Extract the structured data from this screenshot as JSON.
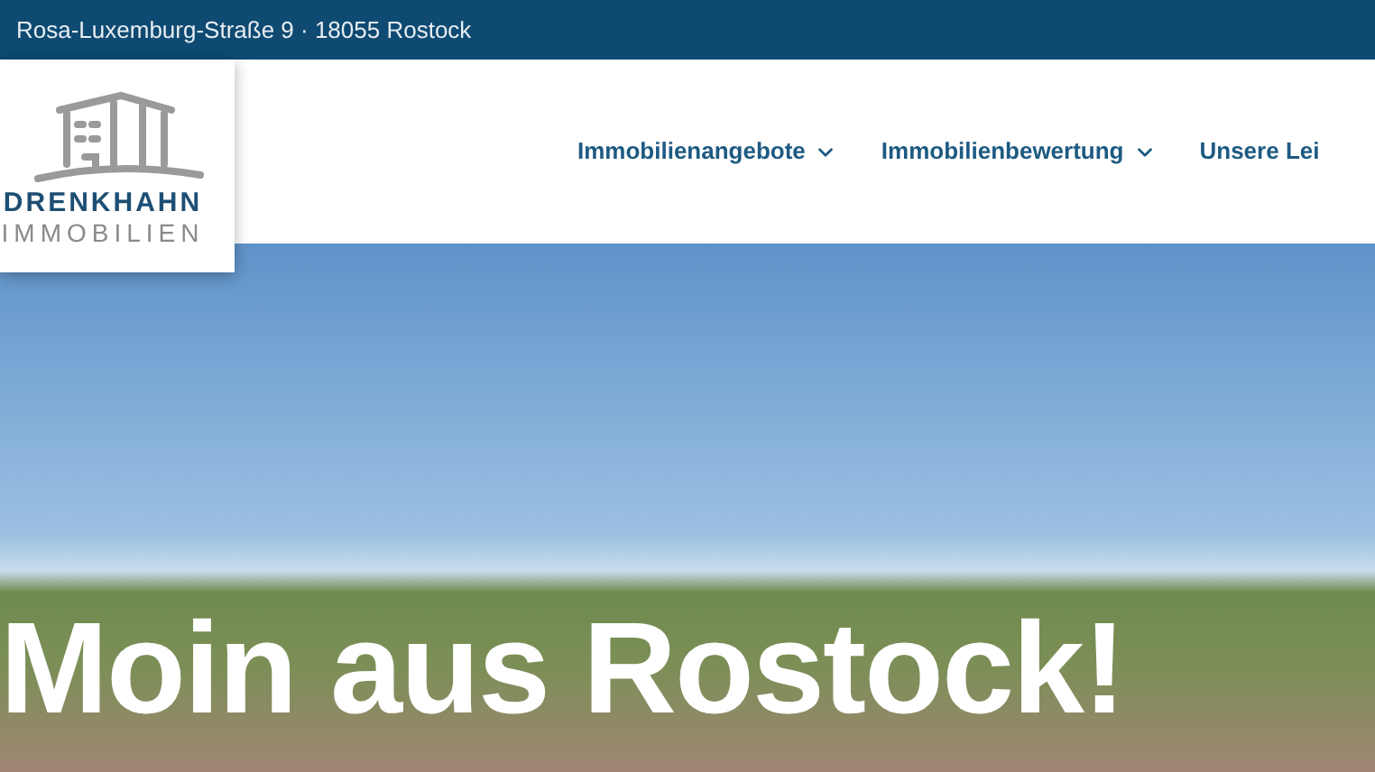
{
  "top_bar": {
    "address": "Rosa-Luxemburg-Straße 9 · 18055 Rostock"
  },
  "logo": {
    "name": "DRENKHAHN",
    "subtitle": "IMMOBILIEN"
  },
  "nav": [
    {
      "label": "Immobilienangebote",
      "has_dropdown": true
    },
    {
      "label": "Immobilienbewertung",
      "has_dropdown": true
    },
    {
      "label": "Unsere Lei",
      "has_dropdown": false
    }
  ],
  "hero": {
    "heading": "Moin aus Rostock!"
  }
}
